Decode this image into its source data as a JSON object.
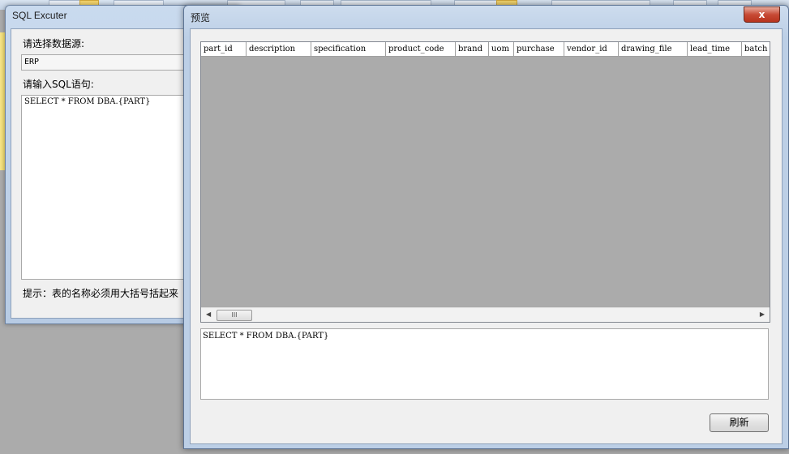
{
  "sql_executer": {
    "title": "SQL Excuter",
    "datasource_label": "请选择数据源:",
    "datasource_value": "ERP",
    "sql_label": "请输入SQL语句:",
    "sql_text": "SELECT * FROM DBA.{PART}",
    "hint": "提示：表的名称必须用大括号括起来"
  },
  "preview": {
    "title": "预览",
    "close_label": "x",
    "columns": [
      "part_id",
      "description",
      "specification",
      "product_code",
      "brand",
      "uom",
      "purchase",
      "vendor_id",
      "drawing_file",
      "lead_time",
      "batch"
    ],
    "scroll_thumb": "III",
    "sql_text": "SELECT * FROM DBA.{PART}",
    "refresh_label": "刷新"
  }
}
